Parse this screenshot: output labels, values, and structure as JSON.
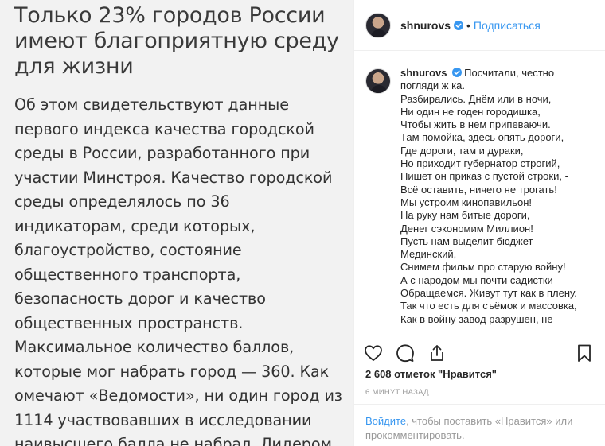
{
  "image": {
    "title_lines": [
      "Только 23% городов России",
      "имеют благоприятную среду",
      "для жизни"
    ],
    "body_lines": [
      "Об этом свидетельствуют данные",
      "первого индекса качества городской",
      "среды в России, разработанного при",
      "участии Минстроя. Качество городской",
      "среды определялось по 36",
      "индикаторам, среди которых,",
      "благоустройство, состояние",
      "общественного транспорта,",
      "безопасность дорог и качество",
      "общественных пространств.",
      "Максимальное количество баллов,",
      "которые мог набрать город — 360. Как",
      "омечают «Ведомости», ни один город из",
      "1114 участвовавших в исследовании",
      "наивысшего балла не набрал. Лидером"
    ]
  },
  "header": {
    "username": "shnurovs",
    "separator": "•",
    "follow_label": "Подписаться",
    "verified_icon": "verified-badge-icon",
    "accent_color": "#3897f0"
  },
  "caption": {
    "username": "shnurovs",
    "first_line": "Посчитали, честно",
    "lines": [
      "погляди ж ка.",
      "Разбирались. Днём или в ночи,",
      "Ни один не годен городишка,",
      "Чтобы жить в нем припеваючи.",
      "Там помойка, здесь опять дороги,",
      "Где дороги, там и дураки,",
      "Но приходит губернатор строгий,",
      "Пишет он приказ с пустой строки, -",
      "Всё оставить, ничего не трогать!",
      "Мы устроим кинопавильон!",
      "На руку нам битые дороги,",
      "Денег сэкономим Миллион!",
      "Пусть нам выделит бюджет",
      "Мединский,",
      "Снимем фильм про старую войну!",
      "А с народом мы почти садистки",
      "Обращаемся. Живут тут как в плену.",
      "Так что есть для съёмок и массовка,",
      "Как в войну завод разрушен, не"
    ]
  },
  "actions": {
    "icons": [
      "heart-icon",
      "comment-icon",
      "share-icon",
      "bookmark-icon"
    ]
  },
  "likes_text": "2 608 отметок \"Нравится\"",
  "timestamp": "6 минут назад",
  "login_prompt": {
    "link_text": "Войдите",
    "rest_text": ", чтобы поставить «Нравится» или прокомментировать."
  }
}
